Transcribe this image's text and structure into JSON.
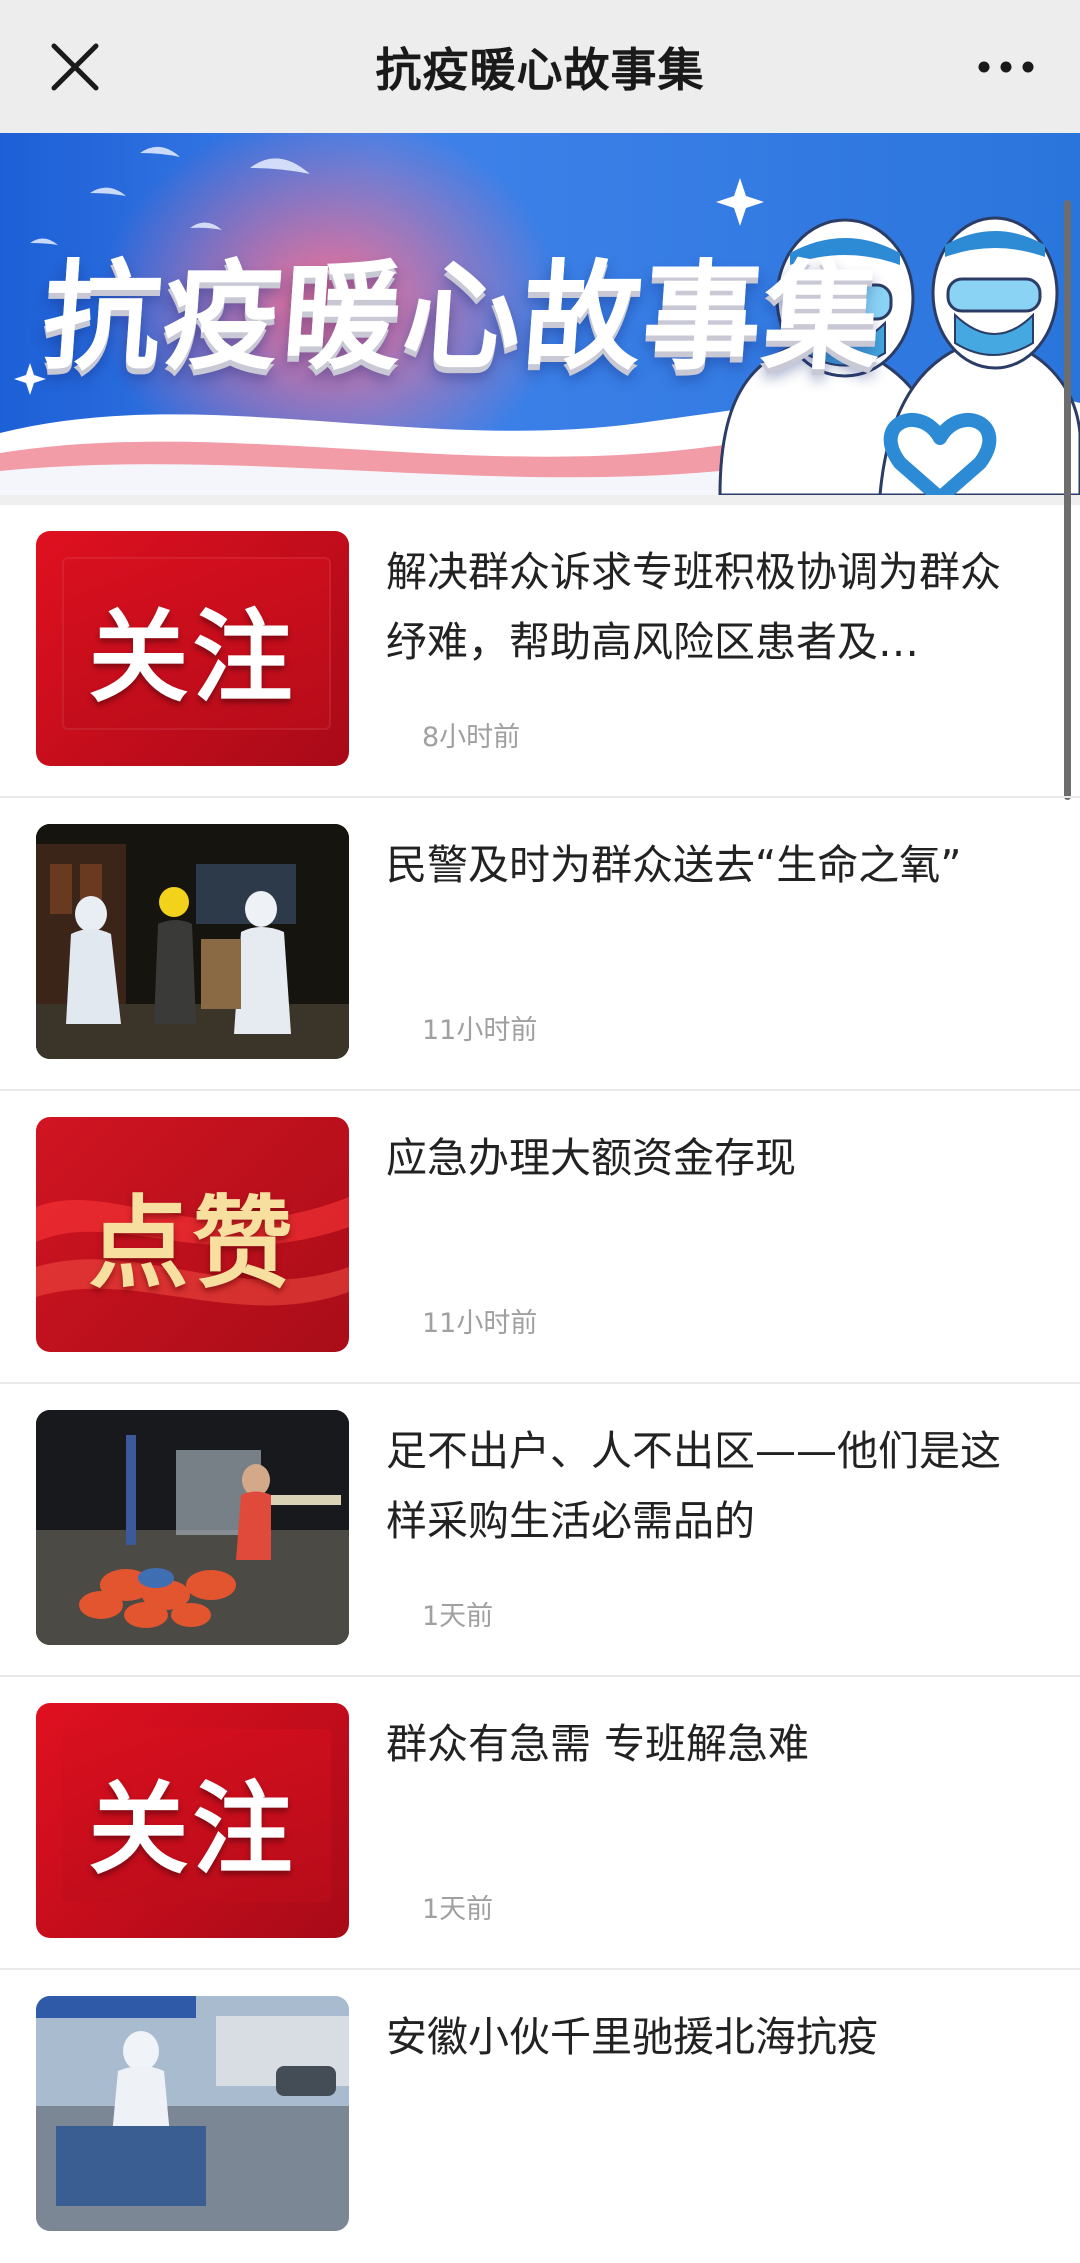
{
  "header": {
    "title": "抗疫暖心故事集",
    "close_icon": "close-icon",
    "more_icon": "more-dots-icon"
  },
  "banner": {
    "title": "抗疫暖心故事集"
  },
  "articles": [
    {
      "title": "解决群众诉求专班积极协调为群众纾难，帮助高风险区患者及…",
      "time": "8小时前",
      "thumb_text": "关注",
      "thumb_type": "tag-red"
    },
    {
      "title": "民警及时为群众送去“生命之氧”",
      "time": "11小时前",
      "thumb_type": "photo-night-delivery"
    },
    {
      "title": "应急办理大额资金存现",
      "time": "11小时前",
      "thumb_text": "点赞",
      "thumb_type": "tag-ribbon"
    },
    {
      "title": "足不出户、人不出区——他们是这样采购生活必需品的",
      "time": "1天前",
      "thumb_type": "photo-supplies"
    },
    {
      "title": "群众有急需 专班解急难",
      "time": "1天前",
      "thumb_text": "关注",
      "thumb_type": "tag-red"
    },
    {
      "title": "安徽小伙千里驰援北海抗疫",
      "time": "",
      "thumb_type": "photo-disinfection"
    }
  ],
  "colors": {
    "topbar_bg": "#ededed",
    "tag_red": "#c8101e",
    "tag_gold": "#f7dfa0",
    "banner_blue": "#2f7fe0"
  }
}
